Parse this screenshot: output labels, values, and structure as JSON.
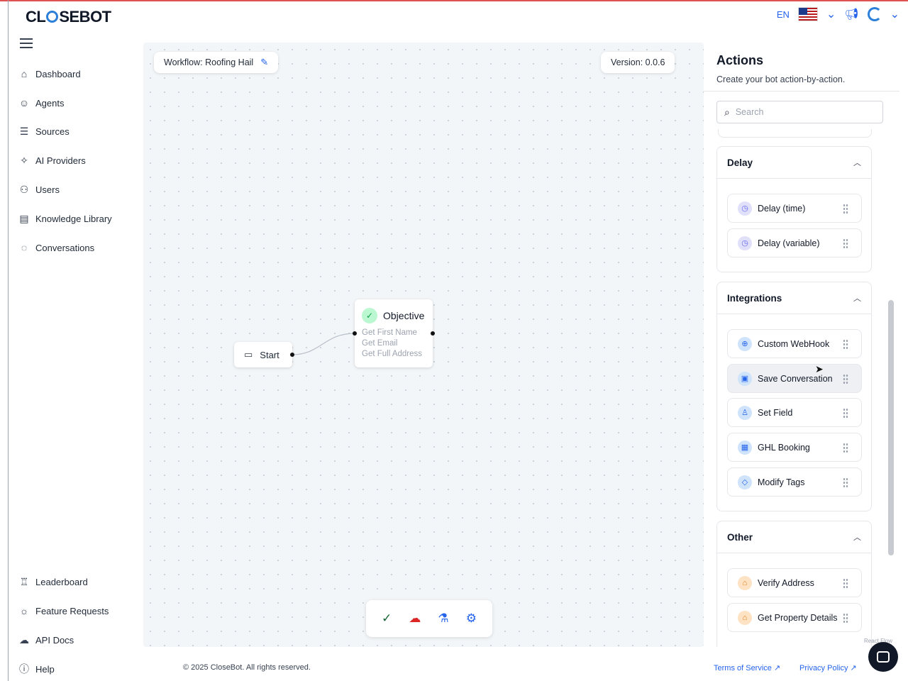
{
  "header": {
    "brand": "CLOSEBOT",
    "brand_pre": "CL",
    "brand_post": "SEBOT",
    "language": "EN"
  },
  "sidebar": {
    "items": [
      {
        "label": "Dashboard",
        "icon": "home-icon"
      },
      {
        "label": "Agents",
        "icon": "robot-icon"
      },
      {
        "label": "Sources",
        "icon": "database-icon"
      },
      {
        "label": "AI Providers",
        "icon": "sparkle-icon"
      },
      {
        "label": "Users",
        "icon": "users-icon"
      },
      {
        "label": "Knowledge Library",
        "icon": "book-icon"
      },
      {
        "label": "Conversations",
        "icon": "chat-icon"
      }
    ],
    "bottom_items": [
      {
        "label": "Leaderboard",
        "icon": "trophy-icon"
      },
      {
        "label": "Feature Requests",
        "icon": "lightbulb-icon"
      },
      {
        "label": "API Docs",
        "icon": "cloud-icon"
      },
      {
        "label": "Help",
        "icon": "help-icon"
      }
    ]
  },
  "canvas": {
    "workflow_label": "Workflow: Roofing Hail",
    "version_label": "Version: 0.0.6",
    "start_node": "Start",
    "objective_node": {
      "title": "Objective",
      "lines": [
        "Get First Name",
        "Get Email",
        "Get Full Address"
      ]
    },
    "toolbar": [
      "check-circle-icon",
      "cloud-alert-icon",
      "flask-icon",
      "gear-icon"
    ],
    "attribution": "React Flow"
  },
  "actions_panel": {
    "title": "Actions",
    "subtitle": "Create your bot action-by-action.",
    "search_placeholder": "Search",
    "sections": [
      {
        "title": "Delay",
        "items": [
          "Delay (time)",
          "Delay (variable)"
        ]
      },
      {
        "title": "Integrations",
        "items": [
          "Custom WebHook",
          "Save Conversation",
          "Set Field",
          "GHL Booking",
          "Modify Tags"
        ]
      },
      {
        "title": "Other",
        "items": [
          "Verify Address",
          "Get Property Details"
        ]
      }
    ]
  },
  "footer": {
    "copyright": "© 2025 CloseBot. All rights reserved.",
    "terms": "Terms of Service",
    "privacy": "Privacy Policy"
  },
  "colors": {
    "accent": "#2563eb",
    "success": "#16a34a",
    "delay_icon": "#6366f1",
    "integration_icon": "#2563eb",
    "other_icon": "#ea7a17"
  }
}
